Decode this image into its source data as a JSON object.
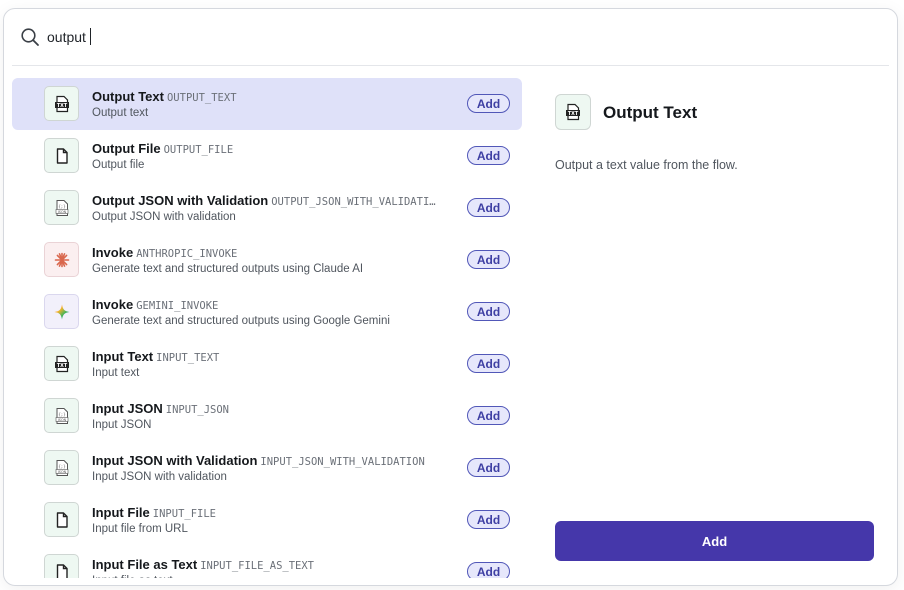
{
  "search": {
    "value": "output",
    "placeholder": ""
  },
  "results": [
    {
      "name": "Output Text",
      "code": "OUTPUT_TEXT",
      "description": "Output text",
      "icon": "text-file-icon",
      "add_label": "Add",
      "selected": true
    },
    {
      "name": "Output File",
      "code": "OUTPUT_FILE",
      "description": "Output file",
      "icon": "file-icon",
      "add_label": "Add"
    },
    {
      "name": "Output JSON with Validation",
      "code": "OUTPUT_JSON_WITH_VALIDATI…",
      "description": "Output JSON with validation",
      "icon": "json-file-icon",
      "add_label": "Add"
    },
    {
      "name": "Invoke",
      "code": "ANTHROPIC_INVOKE",
      "description": "Generate text and structured outputs using Claude AI",
      "icon": "anthropic-icon",
      "add_label": "Add"
    },
    {
      "name": "Invoke",
      "code": "GEMINI_INVOKE",
      "description": "Generate text and structured outputs using Google Gemini",
      "icon": "gemini-icon",
      "add_label": "Add"
    },
    {
      "name": "Input Text",
      "code": "INPUT_TEXT",
      "description": "Input text",
      "icon": "text-file-icon",
      "add_label": "Add"
    },
    {
      "name": "Input JSON",
      "code": "INPUT_JSON",
      "description": "Input JSON",
      "icon": "json-file-icon",
      "add_label": "Add"
    },
    {
      "name": "Input JSON with Validation",
      "code": "INPUT_JSON_WITH_VALIDATION",
      "description": "Input JSON with validation",
      "icon": "json-file-icon",
      "add_label": "Add"
    },
    {
      "name": "Input File",
      "code": "INPUT_FILE",
      "description": "Input file from URL",
      "icon": "file-icon",
      "add_label": "Add"
    },
    {
      "name": "Input File as Text",
      "code": "INPUT_FILE_AS_TEXT",
      "description": "Input file as text",
      "icon": "file-icon",
      "add_label": "Add"
    }
  ],
  "detail": {
    "title": "Output Text",
    "description": "Output a text value from the flow.",
    "icon": "text-file-icon"
  },
  "primary_button": {
    "label": "Add"
  },
  "colors": {
    "accent": "#4537aa",
    "selected_row": "#dfe1f9",
    "add_pill_border": "#5157b8",
    "icon_bg": "#eef8f2"
  }
}
